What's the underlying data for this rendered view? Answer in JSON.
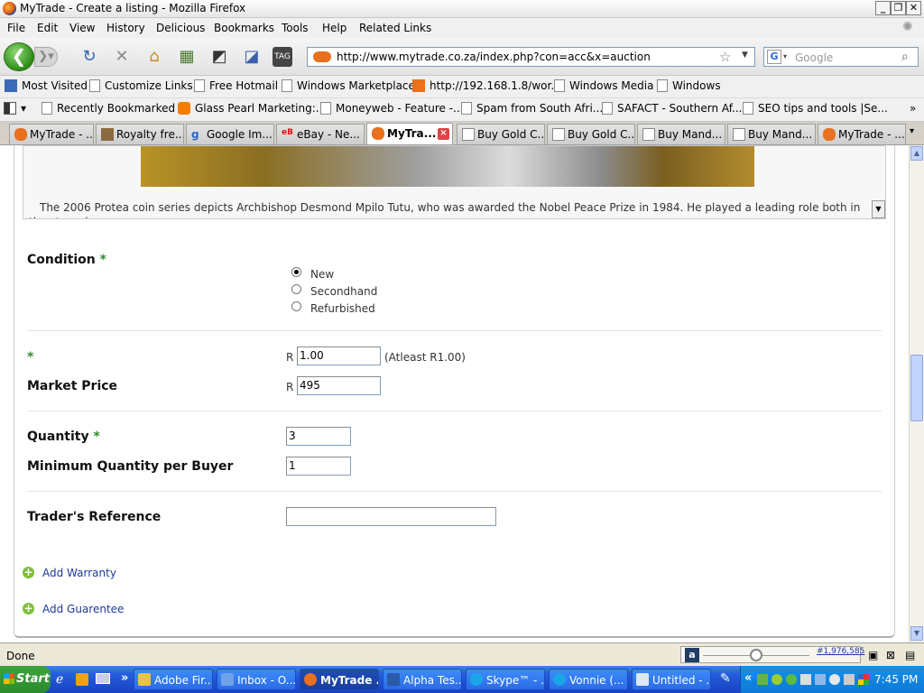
{
  "window": {
    "title": "MyTrade - Create a listing - Mozilla Firefox"
  },
  "menu": [
    "File",
    "Edit",
    "View",
    "History",
    "Delicious",
    "Bookmarks",
    "Tools",
    "Help",
    "Related Links"
  ],
  "nav": {
    "url": "http://www.mytrade.co.za/index.php?con=acc&x=auction",
    "search_placeholder": "Google"
  },
  "bookmarks_bar": [
    "Most Visited",
    "Customize Links",
    "Free Hotmail",
    "Windows Marketplace",
    "http://192.168.1.8/wor...",
    "Windows Media",
    "Windows"
  ],
  "bookmarks_bar2": [
    "Recently Bookmarked",
    "Glass Pearl Marketing:...",
    "Moneyweb - Feature -...",
    "Spam from South Afri...",
    "SAFACT - Southern Af...",
    "SEO tips and tools |Se..."
  ],
  "tabs": [
    "MyTrade - ...",
    "Royalty fre...",
    "Google Im...",
    "eBay - Ne...",
    "MyTra...",
    "Buy Gold C...",
    "Buy Gold C...",
    "Buy Mand...",
    "Buy Mand...",
    "MyTrade - ..."
  ],
  "description": "The 2006 Protea coin series depicts Archbishop Desmond Mpilo Tutu, who was awarded the Nobel Peace Prize in 1984. He played a leading role both in the struggle",
  "form": {
    "condition_label": "Condition",
    "required_mark": "*",
    "condition_options": [
      "New",
      "Secondhand",
      "Refurbished"
    ],
    "condition_selected": "New",
    "currency": "R",
    "start_price_value": "1.00",
    "start_price_hint": "(Atleast R1.00)",
    "market_price_label": "Market Price",
    "market_price_value": "495",
    "quantity_label": "Quantity",
    "quantity_value": "3",
    "min_qty_label": "Minimum Quantity per Buyer",
    "min_qty_value": "1",
    "trader_ref_label": "Trader's Reference",
    "trader_ref_value": "",
    "add_warranty": "Add Warranty",
    "add_guarantee": "Add Guarentee"
  },
  "status": {
    "text": "Done",
    "alexa_rank": "#1,976,585"
  },
  "taskbar": {
    "start": "Start",
    "items": [
      "Adobe Fir...",
      "Inbox - O...",
      "MyTrade ...",
      "Alpha Tes...",
      "Skype™ - ...",
      "Vonnie (...",
      "Untitled - ..."
    ],
    "clock": "7:45 PM"
  }
}
